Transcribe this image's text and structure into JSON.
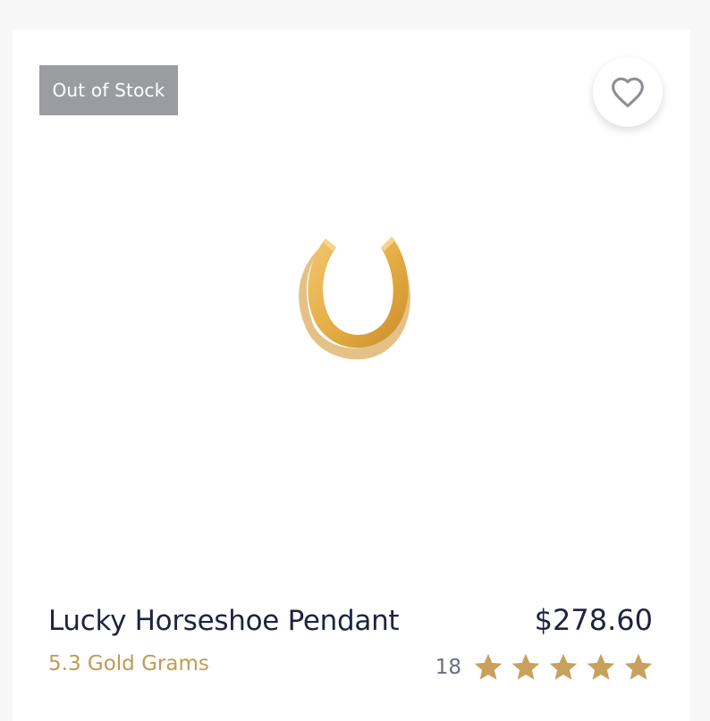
{
  "badge": {
    "label": "Out of Stock"
  },
  "favorite": {
    "icon": "heart-icon"
  },
  "product": {
    "image_icon": "horseshoe-pendant-image",
    "name": "Lucky Horseshoe Pendant",
    "weight": "5.3 Gold Grams",
    "price": "$278.60",
    "rating_count": "18",
    "rating_value": 5,
    "rating_max": 5
  },
  "colors": {
    "gold": "#c29a54",
    "star": "#c9a15c",
    "badge_bg": "#9a9ca1",
    "title": "#1f2340"
  }
}
